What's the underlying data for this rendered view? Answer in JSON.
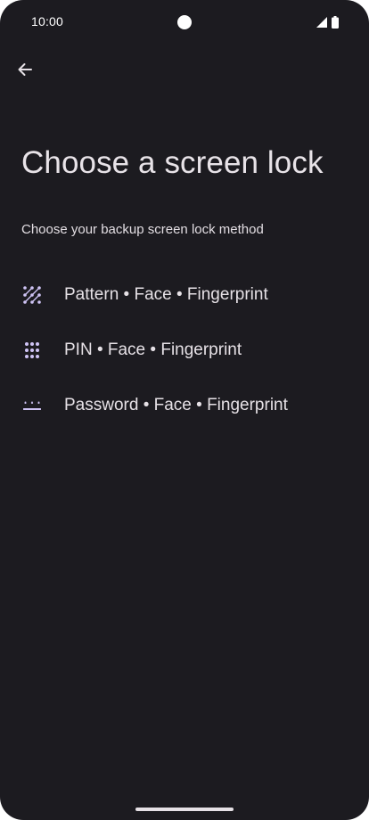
{
  "status_bar": {
    "time": "10:00",
    "icons": [
      "signal-icon",
      "battery-icon"
    ]
  },
  "header": {
    "back_icon": "back-arrow-icon"
  },
  "main": {
    "title": "Choose a screen lock",
    "subtitle": "Choose your backup screen lock method",
    "options": [
      {
        "icon": "pattern-icon",
        "label": "Pattern • Face • Fingerprint"
      },
      {
        "icon": "pin-icon",
        "label": "PIN • Face • Fingerprint"
      },
      {
        "icon": "password-icon",
        "label": "Password • Face • Fingerprint"
      }
    ]
  },
  "colors": {
    "background": "#1c1b20",
    "text": "#e6e1e6",
    "icon_accent": "#cfc4f5"
  }
}
